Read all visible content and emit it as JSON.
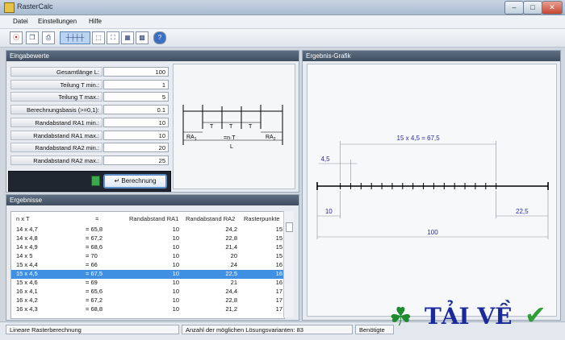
{
  "window": {
    "title": "RasterCalc",
    "minimize": "–",
    "maximize": "□",
    "close": "✕"
  },
  "menu": [
    "Datei",
    "Einstellungen",
    "Hilfe"
  ],
  "toolbar": {
    "icons": [
      "exit-icon",
      "copy-icon",
      "print-icon",
      "grid-lines-icon",
      "frame-icon",
      "fit-icon",
      "grid-icon",
      "grid-dense-icon",
      "help-icon"
    ],
    "help_label": "?"
  },
  "input": {
    "title": "Eingabewerte",
    "fields": [
      {
        "label": "Gesamtlänge L:",
        "value": "100"
      },
      {
        "label": "Teilung T min.:",
        "value": "1"
      },
      {
        "label": "Teilung T max.:",
        "value": "5"
      },
      {
        "label": "Berechnungsbasis (>=0,1):",
        "value": "0.1"
      },
      {
        "label": "Randabstand RA1 min.:",
        "value": "10"
      },
      {
        "label": "Randabstand RA1 max.:",
        "value": "10"
      },
      {
        "label": "Randabstand RA2 min.:",
        "value": "20"
      },
      {
        "label": "Randabstand RA2 max.:",
        "value": "25"
      }
    ],
    "button": "Berechnung"
  },
  "diagram": {
    "t1": "T",
    "t2": "T",
    "t3": "T",
    "ra1": "RA",
    "ra1_sub": "1",
    "ra2": "RA",
    "ra2_sub": "2",
    "nt": "=n·T",
    "l": "L"
  },
  "results": {
    "title": "Ergebnisse",
    "columns": [
      "n x T",
      "=",
      "Randabstand RA1",
      "Randabstand RA2",
      "Rasterpunkte"
    ],
    "rows": [
      [
        "14 x 4,7",
        "= 65,8",
        "10",
        "24,2",
        "15"
      ],
      [
        "14 x 4,8",
        "= 67,2",
        "10",
        "22,8",
        "15"
      ],
      [
        "14 x 4,9",
        "= 68,6",
        "10",
        "21,4",
        "15"
      ],
      [
        "14 x 5",
        "= 70",
        "10",
        "20",
        "15"
      ],
      [
        "15 x 4,4",
        "= 66",
        "10",
        "24",
        "16"
      ],
      [
        "15 x 4,5",
        "= 67,5",
        "10",
        "22,5",
        "16"
      ],
      [
        "15 x 4,6",
        "= 69",
        "10",
        "21",
        "16"
      ],
      [
        "16 x 4,1",
        "= 65,6",
        "10",
        "24,4",
        "17"
      ],
      [
        "16 x 4,2",
        "= 67,2",
        "10",
        "22,8",
        "17"
      ],
      [
        "16 x 4,3",
        "= 68,8",
        "10",
        "21,2",
        "17"
      ]
    ],
    "selected_index": 5
  },
  "graphic": {
    "title": "Ergebnis-Grafik",
    "top_label": "15 x 4,5 = 67,5",
    "pitch_label": "4,5",
    "ra1_label": "10",
    "ra2_label": "22,5",
    "total_label": "100",
    "ticks": 16
  },
  "status": {
    "mode": "Lineare Rasterberechnung",
    "count": "Anzahl der möglichen Lösungsvarianten: 83",
    "time": "Benötigte"
  },
  "watermark": {
    "text": "TẢI VỀ"
  },
  "colors": {
    "accent": "#3f8fe3",
    "header": "#4a5a6d",
    "dim_blue": "#2a2aa0"
  }
}
